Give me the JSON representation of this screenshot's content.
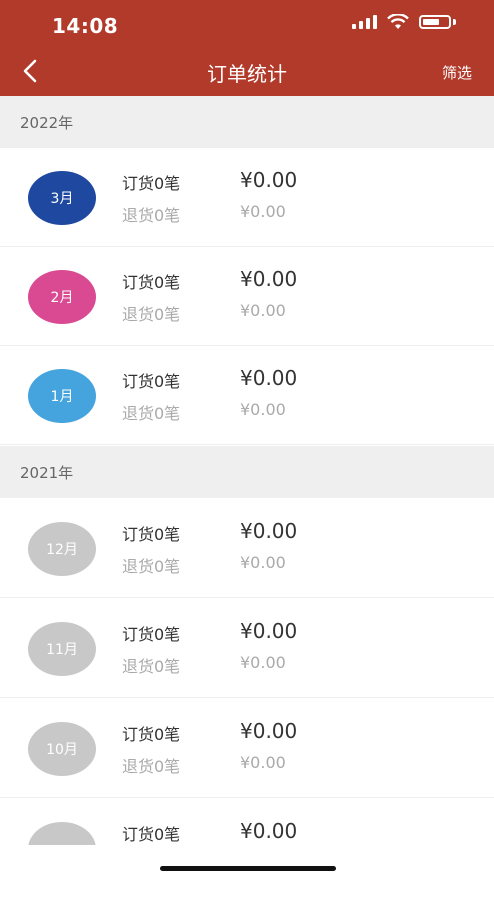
{
  "status": {
    "time": "14:08"
  },
  "header": {
    "title": "订单统计",
    "filter_label": "筛选"
  },
  "colors": {
    "header_bg": "#B23A2A",
    "month_3": "#1F49A0",
    "month_2": "#D94A92",
    "month_1": "#45A3DE",
    "inactive": "#C8C8C8"
  },
  "sections": [
    {
      "year": "2022年",
      "rows": [
        {
          "month": "3月",
          "order_label": "订货0笔",
          "order_amount": "¥0.00",
          "return_label": "退货0笔",
          "return_amount": "¥0.00"
        },
        {
          "month": "2月",
          "order_label": "订货0笔",
          "order_amount": "¥0.00",
          "return_label": "退货0笔",
          "return_amount": "¥0.00"
        },
        {
          "month": "1月",
          "order_label": "订货0笔",
          "order_amount": "¥0.00",
          "return_label": "退货0笔",
          "return_amount": "¥0.00"
        }
      ]
    },
    {
      "year": "2021年",
      "rows": [
        {
          "month": "12月",
          "order_label": "订货0笔",
          "order_amount": "¥0.00",
          "return_label": "退货0笔",
          "return_amount": "¥0.00"
        },
        {
          "month": "11月",
          "order_label": "订货0笔",
          "order_amount": "¥0.00",
          "return_label": "退货0笔",
          "return_amount": "¥0.00"
        },
        {
          "month": "10月",
          "order_label": "订货0笔",
          "order_amount": "¥0.00",
          "return_label": "退货0笔",
          "return_amount": "¥0.00"
        },
        {
          "month": "",
          "order_label": "订货0笔",
          "order_amount": "¥0.00",
          "return_label": "",
          "return_amount": ""
        }
      ]
    }
  ]
}
